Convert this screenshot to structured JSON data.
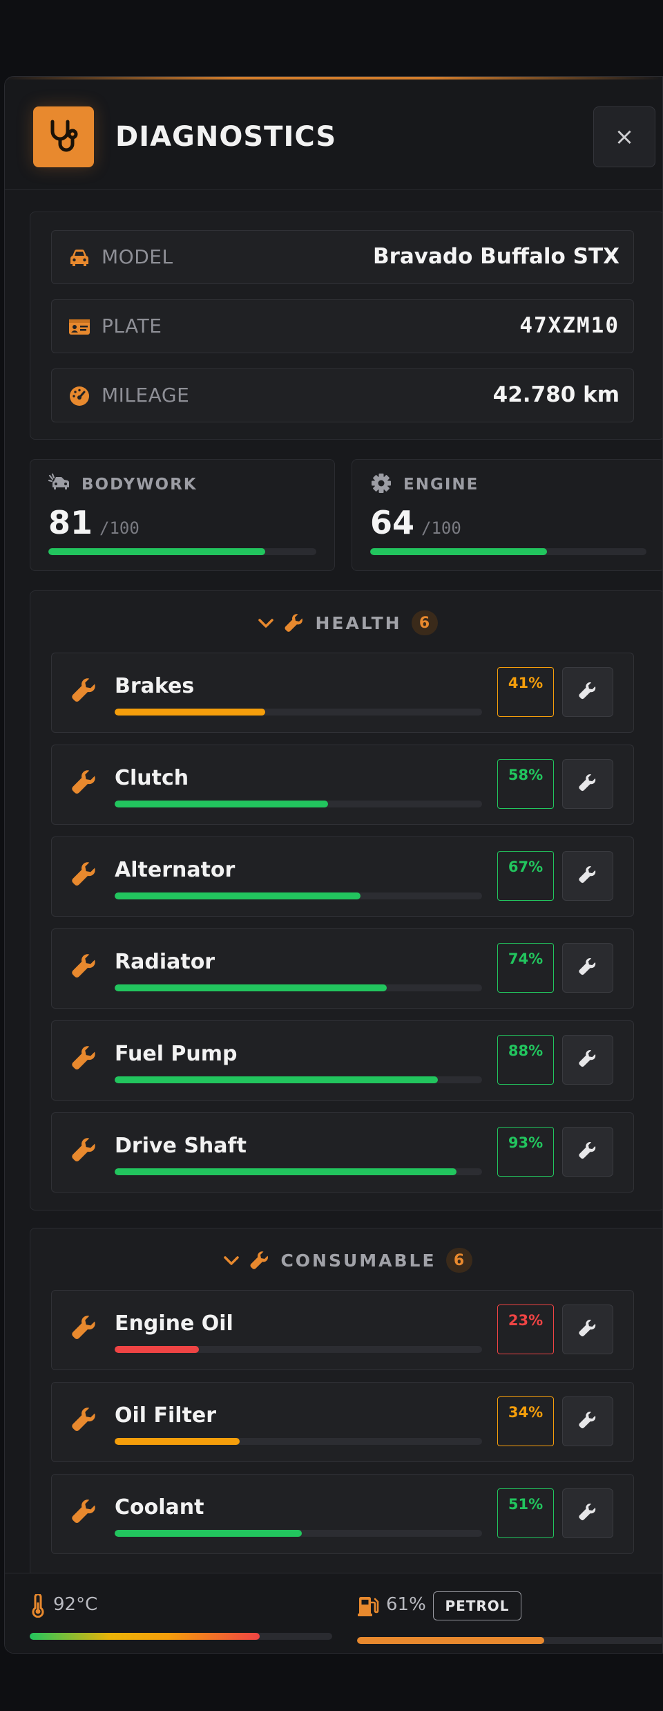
{
  "header": {
    "title": "DIAGNOSTICS",
    "close_label": "×",
    "icon": "stethoscope-icon"
  },
  "vehicle": {
    "model_label": "MODEL",
    "model_value": "Bravado Buffalo STX",
    "plate_label": "PLATE",
    "plate_value": "47XZM10",
    "mileage_label": "MILEAGE",
    "mileage_value": "42.780 km"
  },
  "stats": {
    "bodywork": {
      "label": "BODYWORK",
      "value": 81,
      "max": "/100"
    },
    "engine": {
      "label": "ENGINE",
      "value": 64,
      "max": "/100"
    }
  },
  "health": {
    "title": "HEALTH",
    "count": "6",
    "parts": [
      {
        "name": "Brakes",
        "pct": 41,
        "pct_label": "41%"
      },
      {
        "name": "Clutch",
        "pct": 58,
        "pct_label": "58%"
      },
      {
        "name": "Alternator",
        "pct": 67,
        "pct_label": "67%"
      },
      {
        "name": "Radiator",
        "pct": 74,
        "pct_label": "74%"
      },
      {
        "name": "Fuel Pump",
        "pct": 88,
        "pct_label": "88%"
      },
      {
        "name": "Drive Shaft",
        "pct": 93,
        "pct_label": "93%"
      }
    ]
  },
  "consumable": {
    "title": "CONSUMABLE",
    "count": "6",
    "parts": [
      {
        "name": "Engine Oil",
        "pct": 23,
        "pct_label": "23%"
      },
      {
        "name": "Oil Filter",
        "pct": 34,
        "pct_label": "34%"
      },
      {
        "name": "Coolant",
        "pct": 51,
        "pct_label": "51%"
      }
    ]
  },
  "footer": {
    "temp_label": "92°C",
    "temp_level": 76,
    "fuel_label": "61%",
    "fuel_level": 61,
    "fuel_type": "PETROL"
  },
  "colors": {
    "accent": "#e8892e",
    "good": "#22c55e",
    "warn": "#f59e0b",
    "bad": "#ef4444"
  }
}
